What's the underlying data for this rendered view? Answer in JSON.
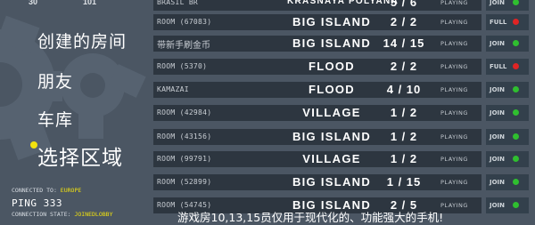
{
  "top_partial": {
    "left_a": "30",
    "left_b": "101"
  },
  "menu": {
    "create_room": "创建的房间",
    "friends": "朋友",
    "garage": "车库",
    "select_region": "选择区域"
  },
  "connection": {
    "connected_to_label": "CONNECTED TO:",
    "region": "EUROPE",
    "ping_label": "PING",
    "ping_value": "333",
    "state_label": "CONNECTION STATE:",
    "state_value": "JOINEDLOBBY"
  },
  "colors": {
    "accent_yellow": "#f2e20e",
    "status_green": "#2fbf2f",
    "status_red": "#e02424",
    "background": "#4b5663",
    "row_panel": "#2d3640"
  },
  "rooms": [
    {
      "name": "BRASIL BR",
      "map": "KRASNAYA POLYANA",
      "players": "5 / 6",
      "status": "PLAYING",
      "action": "JOIN",
      "light": "green"
    },
    {
      "name": "ROOM (67083)",
      "map": "BIG ISLAND",
      "players": "2 / 2",
      "status": "PLAYING",
      "action": "FULL",
      "light": "red"
    },
    {
      "name": "带新手刷金币",
      "map": "BIG ISLAND",
      "players": "14 / 15",
      "status": "PLAYING",
      "action": "JOIN",
      "light": "green"
    },
    {
      "name": "ROOM (5370)",
      "map": "FLOOD",
      "players": "2 / 2",
      "status": "PLAYING",
      "action": "FULL",
      "light": "red"
    },
    {
      "name": "KAMAZAI",
      "map": "FLOOD",
      "players": "4 / 10",
      "status": "PLAYING",
      "action": "JOIN",
      "light": "green"
    },
    {
      "name": "ROOM (42984)",
      "map": "VILLAGE",
      "players": "1 / 2",
      "status": "PLAYING",
      "action": "JOIN",
      "light": "green"
    },
    {
      "name": "ROOM (43156)",
      "map": "BIG ISLAND",
      "players": "1 / 2",
      "status": "PLAYING",
      "action": "JOIN",
      "light": "green"
    },
    {
      "name": "ROOM (99791)",
      "map": "VILLAGE",
      "players": "1 / 2",
      "status": "PLAYING",
      "action": "JOIN",
      "light": "green"
    },
    {
      "name": "ROOM (52899)",
      "map": "BIG ISLAND",
      "players": "1 / 15",
      "status": "PLAYING",
      "action": "JOIN",
      "light": "green"
    },
    {
      "name": "ROOM (54745)",
      "map": "BIG ISLAND",
      "players": "2 / 5",
      "status": "PLAYING",
      "action": "JOIN",
      "light": "green"
    }
  ],
  "footer_note": "游戏房10,13,15员仅用于现代化的、功能强大的手机!"
}
